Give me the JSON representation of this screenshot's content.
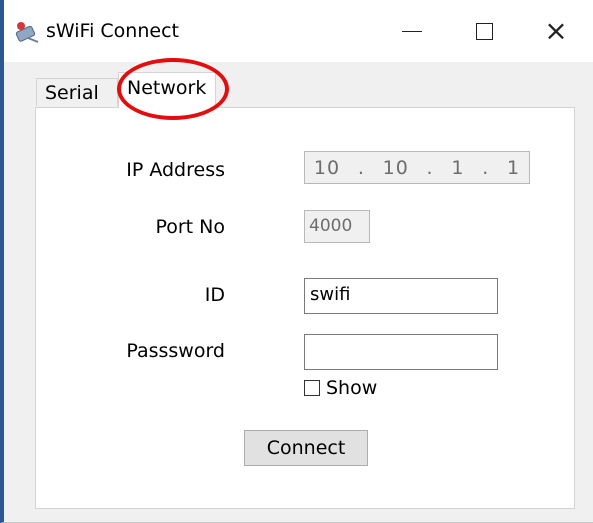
{
  "window": {
    "title": "sWiFi Connect",
    "close_glyph": "×",
    "accent_border": "#2b5797"
  },
  "tabs": [
    {
      "label": "Serial",
      "selected": false
    },
    {
      "label": "Network",
      "selected": true
    }
  ],
  "highlight": {
    "color": "#e30d0d",
    "target": "Network tab"
  },
  "form": {
    "ip_label": "IP Address",
    "ip_octets": [
      "10",
      "10",
      "1",
      "1"
    ],
    "ip_separator": ".",
    "port_label": "Port No",
    "port_value": "4000",
    "id_label": "ID",
    "id_value": "swifi",
    "password_label": "Passsword",
    "password_value": "",
    "show_label": "Show",
    "show_checked": false,
    "connect_label": "Connect"
  },
  "icons": {
    "app": "satellite-dish-icon",
    "minimize": "minimize-icon",
    "maximize": "maximize-icon",
    "close": "close-icon"
  }
}
